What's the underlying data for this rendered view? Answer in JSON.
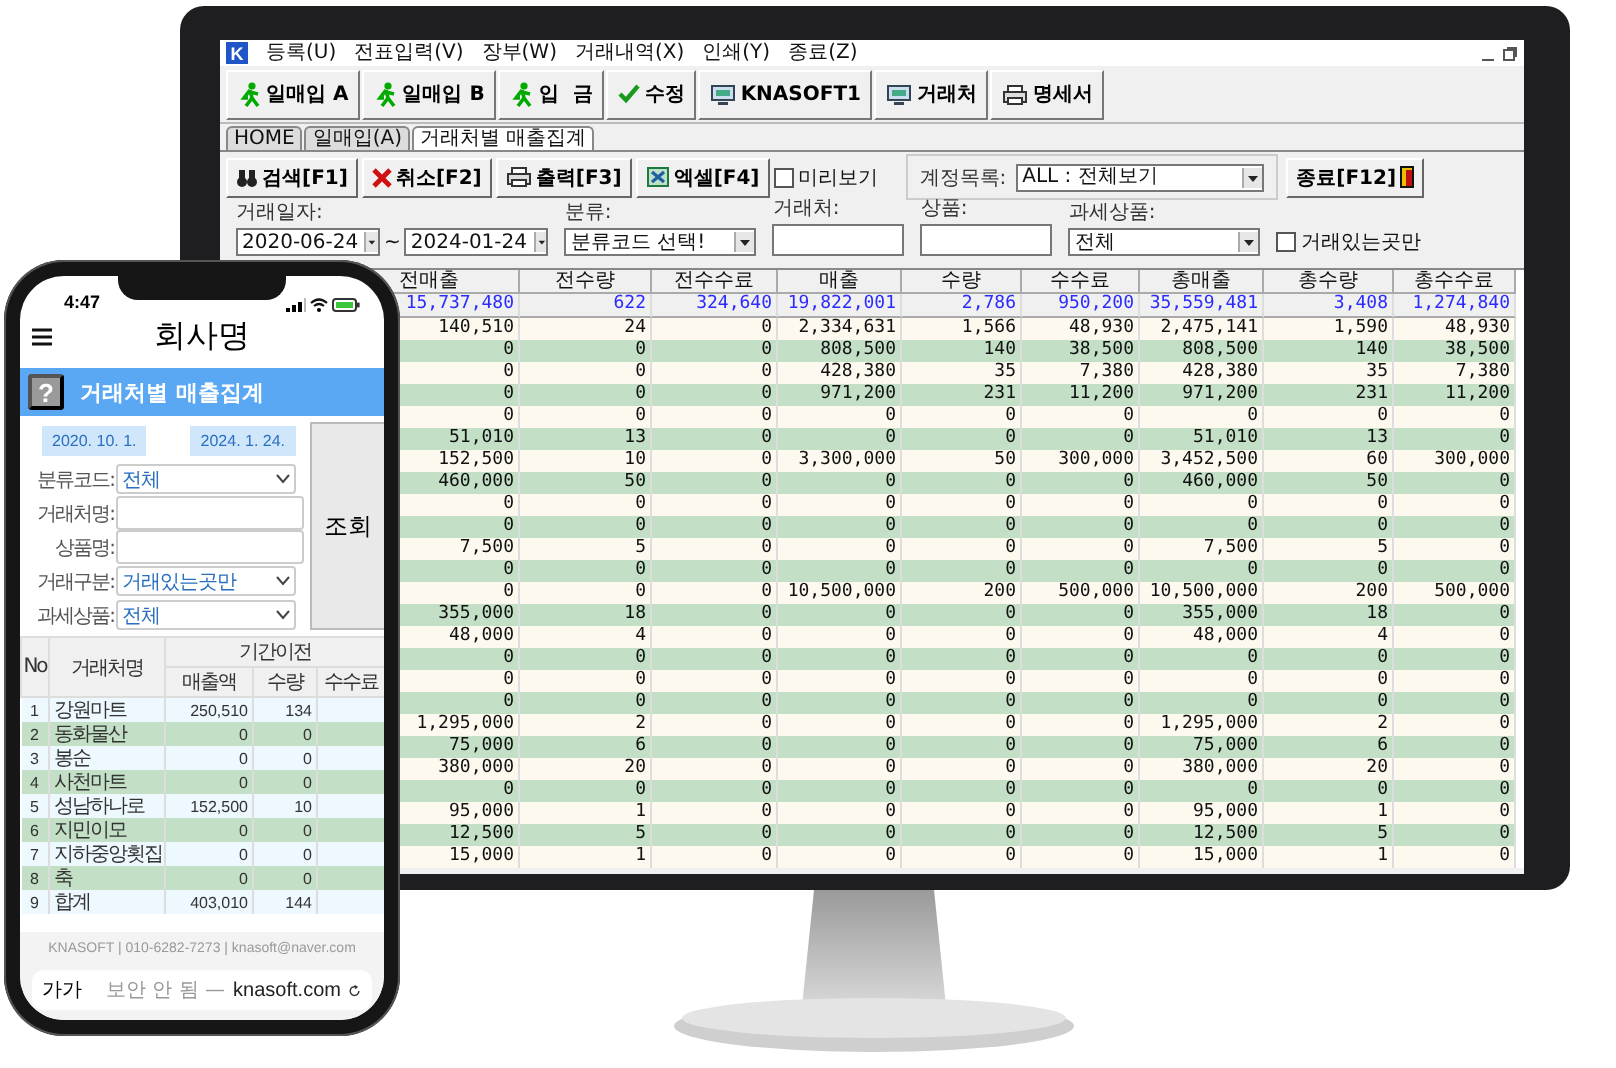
{
  "monitor": {
    "logo": "K",
    "menu": [
      "등록(U)",
      "전표입력(V)",
      "장부(W)",
      "거래내역(X)",
      "인쇄(Y)",
      "종료(Z)"
    ],
    "toolbar": [
      "일매입 A",
      "일매입 B",
      "입  금",
      "수정",
      "KNASOFT1",
      "거래처",
      "명세서"
    ],
    "tabs": [
      {
        "label": "HOME",
        "selected": false
      },
      {
        "label": "일매입(A)",
        "selected": false
      },
      {
        "label": "거래처별 매출집계",
        "selected": true
      }
    ],
    "actions": [
      "검색[F1]",
      "취소[F2]",
      "출력[F3]",
      "엑셀[F4]"
    ],
    "preview": {
      "label": "미리보기",
      "checked": false
    },
    "account": {
      "label": "계정목록:",
      "value": "ALL : 전체보기"
    },
    "exit": "종료[F12]",
    "filters": [
      {
        "kind": "group",
        "label": "거래일자:",
        "fields": [
          {
            "kind": "select",
            "value": "2020-06-24"
          },
          {
            "kind": "separator",
            "value": "~"
          },
          {
            "kind": "select",
            "value": "2024-01-24"
          }
        ]
      },
      {
        "kind": "group",
        "label": "분류:",
        "fields": [
          {
            "kind": "select",
            "value": "분류코드 선택!"
          }
        ]
      },
      {
        "kind": "group",
        "label": "거래처:",
        "fields": [
          {
            "kind": "input"
          }
        ]
      },
      {
        "kind": "group",
        "label": "상품:",
        "fields": [
          {
            "kind": "input"
          }
        ]
      },
      {
        "kind": "group",
        "label": "과세상품:",
        "fields": [
          {
            "kind": "select",
            "value": "전체"
          }
        ]
      },
      {
        "kind": "checkbox",
        "label": "거래있는곳만",
        "checked": false
      }
    ],
    "grid": {
      "columns": [
        "전매출",
        "전수량",
        "전수수료",
        "매출",
        "수량",
        "수수료",
        "총매출",
        "총수량",
        "총수수료"
      ],
      "totals": [
        "15,737,480",
        "622",
        "324,640",
        "19,822,001",
        "2,786",
        "950,200",
        "35,559,481",
        "3,408",
        "1,274,840"
      ],
      "rows": [
        [
          "140,510",
          "24",
          "0",
          "2,334,631",
          "1,566",
          "48,930",
          "2,475,141",
          "1,590",
          "48,930"
        ],
        [
          "0",
          "0",
          "0",
          "808,500",
          "140",
          "38,500",
          "808,500",
          "140",
          "38,500"
        ],
        [
          "0",
          "0",
          "0",
          "428,380",
          "35",
          "7,380",
          "428,380",
          "35",
          "7,380"
        ],
        [
          "0",
          "0",
          "0",
          "971,200",
          "231",
          "11,200",
          "971,200",
          "231",
          "11,200"
        ],
        [
          "0",
          "0",
          "0",
          "0",
          "0",
          "0",
          "0",
          "0",
          "0"
        ],
        [
          "51,010",
          "13",
          "0",
          "0",
          "0",
          "0",
          "51,010",
          "13",
          "0"
        ],
        [
          "152,500",
          "10",
          "0",
          "3,300,000",
          "50",
          "300,000",
          "3,452,500",
          "60",
          "300,000"
        ],
        [
          "460,000",
          "50",
          "0",
          "0",
          "0",
          "0",
          "460,000",
          "50",
          "0"
        ],
        [
          "0",
          "0",
          "0",
          "0",
          "0",
          "0",
          "0",
          "0",
          "0"
        ],
        [
          "0",
          "0",
          "0",
          "0",
          "0",
          "0",
          "0",
          "0",
          "0"
        ],
        [
          "7,500",
          "5",
          "0",
          "0",
          "0",
          "0",
          "7,500",
          "5",
          "0"
        ],
        [
          "0",
          "0",
          "0",
          "0",
          "0",
          "0",
          "0",
          "0",
          "0"
        ],
        [
          "0",
          "0",
          "0",
          "10,500,000",
          "200",
          "500,000",
          "10,500,000",
          "200",
          "500,000"
        ],
        [
          "355,000",
          "18",
          "0",
          "0",
          "0",
          "0",
          "355,000",
          "18",
          "0"
        ],
        [
          "48,000",
          "4",
          "0",
          "0",
          "0",
          "0",
          "48,000",
          "4",
          "0"
        ],
        [
          "0",
          "0",
          "0",
          "0",
          "0",
          "0",
          "0",
          "0",
          "0"
        ],
        [
          "0",
          "0",
          "0",
          "0",
          "0",
          "0",
          "0",
          "0",
          "0"
        ],
        [
          "0",
          "0",
          "0",
          "0",
          "0",
          "0",
          "0",
          "0",
          "0"
        ],
        [
          "1,295,000",
          "2",
          "0",
          "0",
          "0",
          "0",
          "1,295,000",
          "2",
          "0"
        ],
        [
          "75,000",
          "6",
          "0",
          "0",
          "0",
          "0",
          "75,000",
          "6",
          "0"
        ],
        [
          "380,000",
          "20",
          "0",
          "0",
          "0",
          "0",
          "380,000",
          "20",
          "0"
        ],
        [
          "0",
          "0",
          "0",
          "0",
          "0",
          "0",
          "0",
          "0",
          "0"
        ],
        [
          "95,000",
          "1",
          "0",
          "0",
          "0",
          "0",
          "95,000",
          "1",
          "0"
        ],
        [
          "12,500",
          "5",
          "0",
          "0",
          "0",
          "0",
          "12,500",
          "5",
          "0"
        ],
        [
          "15,000",
          "1",
          "0",
          "0",
          "0",
          "0",
          "15,000",
          "1",
          "0"
        ]
      ]
    }
  },
  "phone": {
    "time": "4:47",
    "company": "회사명",
    "help": "?",
    "title": "거래처별 매출집계",
    "dates": [
      "2020. 10. 1.",
      "2024. 1. 24."
    ],
    "fields": [
      {
        "label": "분류코드:",
        "kind": "select",
        "value": "전체"
      },
      {
        "label": "거래처명:",
        "kind": "input"
      },
      {
        "label": "상품명:",
        "kind": "input"
      },
      {
        "label": "거래구분:",
        "kind": "select",
        "value": "거래있는곳만"
      },
      {
        "label": "과세상품:",
        "kind": "select",
        "value": "전체"
      }
    ],
    "search_button": "조회",
    "table": {
      "group": "기간이전",
      "columns": [
        "No",
        "거래처명",
        "매출액",
        "수량",
        "수수료"
      ],
      "rows": [
        [
          "1",
          "강원마트",
          "250,510",
          "134"
        ],
        [
          "2",
          "동화물산",
          "0",
          "0"
        ],
        [
          "3",
          "봉순",
          "0",
          "0"
        ],
        [
          "4",
          "사천마트",
          "0",
          "0"
        ],
        [
          "5",
          "성남하나로",
          "152,500",
          "10"
        ],
        [
          "6",
          "지민이모",
          "0",
          "0"
        ],
        [
          "7",
          "지하중앙횟집",
          "0",
          "0"
        ],
        [
          "8",
          "축",
          "0",
          "0"
        ],
        [
          "9",
          "합계",
          "403,010",
          "144"
        ]
      ]
    },
    "footer": "KNASOFT | 010-6282-7273 | knasoft@naver.com",
    "browser": {
      "button": "가가",
      "security": "보안 안 됨 —",
      "domain": "knasoft.com"
    }
  }
}
